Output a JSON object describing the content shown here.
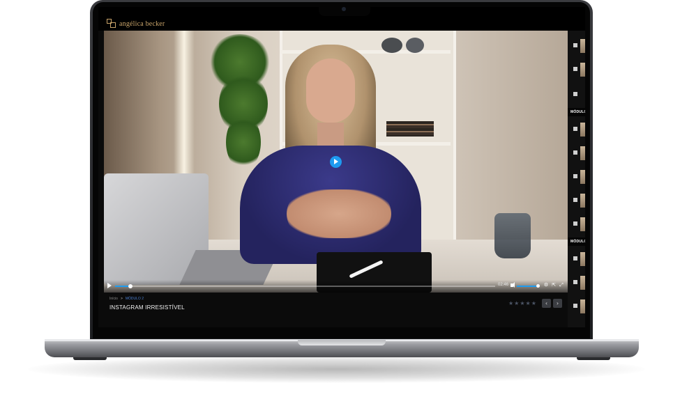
{
  "brand": {
    "logo_text": "angélica becker"
  },
  "breadcrumb": {
    "home": "Início",
    "current": "MÓDULO 2"
  },
  "lesson": {
    "title": "INSTAGRAM IRRESISTÍVEL",
    "rating_stars": "★★★★★",
    "rating_value": 0
  },
  "player": {
    "current_time": "02:46",
    "progress_fraction": 0.04,
    "volume_fraction": 0.95
  },
  "sidebar": {
    "module_label_1": "MÓDULO",
    "module_label_2": "MÓDULO"
  },
  "nav": {
    "prev_glyph": "‹",
    "next_glyph": "›"
  },
  "colors": {
    "accent": "#1e9bf0",
    "gold": "#c9a46a",
    "background": "#0b0b0b"
  }
}
